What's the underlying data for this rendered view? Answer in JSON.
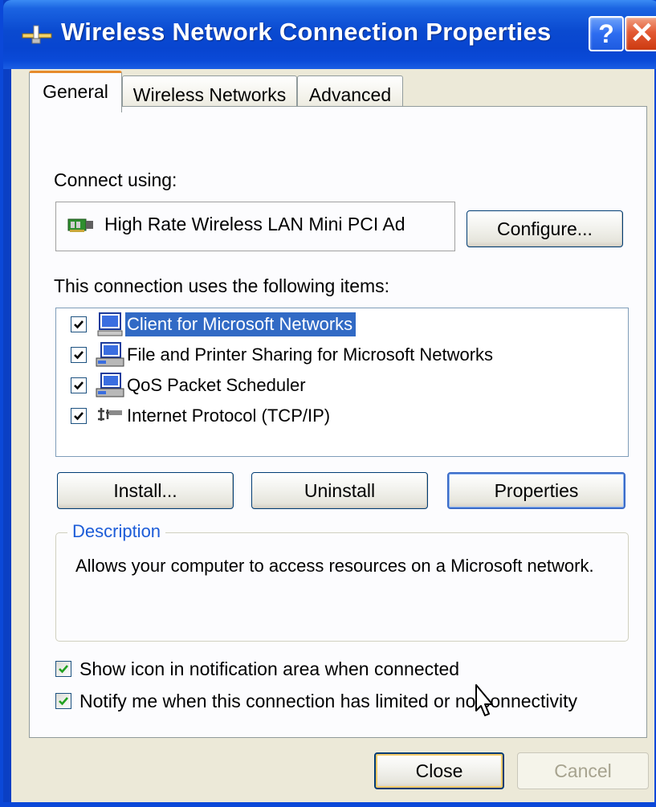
{
  "window": {
    "title": "Wireless Network Connection Properties",
    "help_button": "?",
    "close_button": "✕"
  },
  "tabs": [
    {
      "label": "General",
      "active": true
    },
    {
      "label": "Wireless Networks",
      "active": false
    },
    {
      "label": "Advanced",
      "active": false
    }
  ],
  "general": {
    "connect_using_label": "Connect using:",
    "adapter_name": "High Rate Wireless LAN Mini PCI Ad",
    "configure_button": "Configure...",
    "items_label": "This connection uses the following items:",
    "items": [
      {
        "label": "Client for Microsoft Networks",
        "checked": true,
        "selected": true,
        "icon": "network-client-icon"
      },
      {
        "label": "File and Printer Sharing for Microsoft Networks",
        "checked": true,
        "selected": false,
        "icon": "network-service-icon"
      },
      {
        "label": "QoS Packet Scheduler",
        "checked": true,
        "selected": false,
        "icon": "network-service-icon"
      },
      {
        "label": "Internet Protocol (TCP/IP)",
        "checked": true,
        "selected": false,
        "icon": "protocol-icon"
      }
    ],
    "install_button": "Install...",
    "uninstall_button": "Uninstall",
    "properties_button": "Properties",
    "description_legend": "Description",
    "description_text": "Allows your computer to access resources on a Microsoft network.",
    "show_icon_label": "Show icon in notification area when connected",
    "show_icon_checked": true,
    "notify_label": "Notify me when this connection has limited or no connectivity",
    "notify_checked": true
  },
  "footer": {
    "close_button": "Close",
    "cancel_button": "Cancel"
  },
  "colors": {
    "title_bar": "#0a4ad0",
    "selection": "#316ac5",
    "dialog_bg": "#ece9d8",
    "legend_text": "#1c5cd8"
  }
}
